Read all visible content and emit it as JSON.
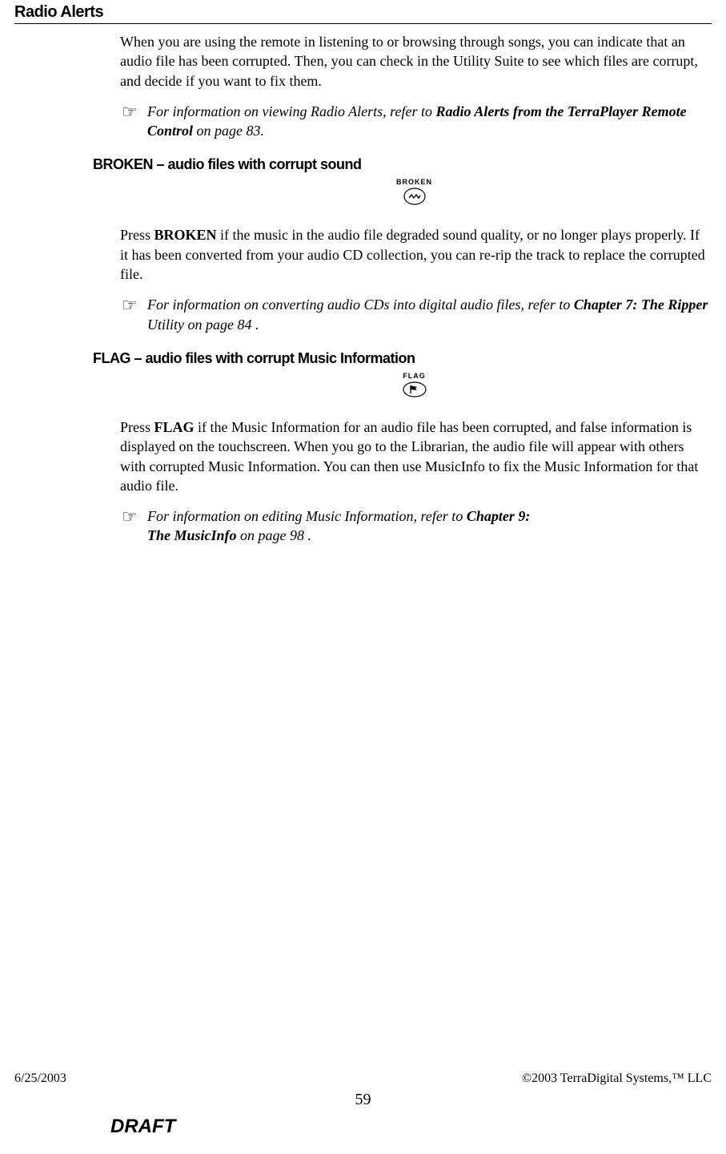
{
  "header": {
    "title": "Radio Alerts"
  },
  "intro": {
    "text": "When you are using the remote in listening to or browsing through songs, you can indicate that an audio file has been corrupted.  Then, you can check in the Utility Suite to see which files are corrupt, and decide if you want to fix them."
  },
  "pointer1": {
    "icon": "☞",
    "prefix": "For information on viewing Radio Alerts, refer to ",
    "bold": "Radio Alerts  from the TerraPlayer Remote Control",
    "suffix": " on page 83."
  },
  "section1": {
    "heading": "BROKEN – audio files with corrupt sound",
    "button_label": "BROKEN",
    "text_pre": "Press ",
    "text_bold": "BROKEN",
    "text_post": " if the music in the audio file degraded sound quality, or no longer plays properly.  If it has been converted from your audio CD collection, you can re-rip the track to replace the corrupted file."
  },
  "pointer2": {
    "icon": "☞",
    "prefix": "For information on converting audio CDs into digital audio files, refer to ",
    "bold": "Chapter 7: The Ripper",
    "suffix": " Utility on page 84 ."
  },
  "section2": {
    "heading": "FLAG – audio files with corrupt Music Information",
    "button_label": "FLAG",
    "text_pre": "Press ",
    "text_bold": "FLAG",
    "text_post": " if the Music Information for an audio file has been corrupted, and false information is displayed on the touchscreen.  When you go to the Librarian, the audio file will appear with others with corrupted Music Information.  You can then use MusicInfo to fix the Music Information for that audio file."
  },
  "pointer3": {
    "icon": "☞",
    "prefix": "For information on editing Music Information, refer to ",
    "bold": "Chapter 9:",
    "break": true,
    "bold2": "The MusicInfo",
    "suffix": " on page 98 ."
  },
  "footer": {
    "date": "6/25/2003",
    "copyright": "©2003 TerraDigital Systems,™ LLC",
    "page": "59",
    "draft": "DRAFT"
  }
}
